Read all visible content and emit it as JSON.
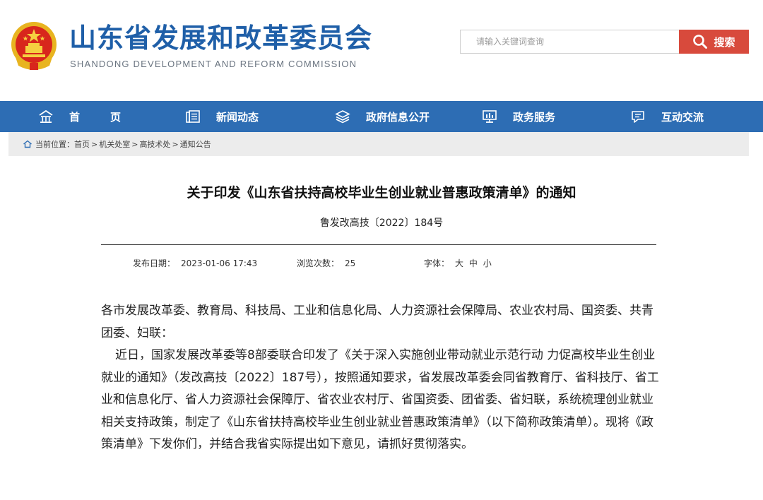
{
  "header": {
    "title": "山东省发展和改革委员会",
    "subtitle": "SHANDONG DEVELOPMENT AND REFORM COMMISSION",
    "emblem_icon": "national-emblem-icon"
  },
  "search": {
    "placeholder": "请输入关键词查询",
    "button_label": "搜索"
  },
  "nav": {
    "items": [
      {
        "label": "首　页",
        "icon": "home-icon"
      },
      {
        "label": "新闻动态",
        "icon": "news-icon"
      },
      {
        "label": "政府信息公开",
        "icon": "layers-icon"
      },
      {
        "label": "政务服务",
        "icon": "monitor-icon"
      },
      {
        "label": "互动交流",
        "icon": "chat-icon"
      }
    ]
  },
  "breadcrumb": {
    "prefix": "当前位置：",
    "items": [
      "首页",
      "机关处室",
      "高技术处",
      "通知公告"
    ],
    "separator": ">"
  },
  "article": {
    "title": "关于印发《山东省扶持高校毕业生创业就业普惠政策清单》的通知",
    "doc_number": "鲁发改高技〔2022〕184号",
    "meta": {
      "publish_label": "发布日期：",
      "publish_date": "2023-01-06 17:43",
      "views_label": "浏览次数：",
      "views": "25",
      "font_label": "字体：",
      "font_large": "大",
      "font_medium": "中",
      "font_small": "小"
    },
    "paragraphs": [
      "各市发展改革委、教育局、科技局、工业和信息化局、人力资源社会保障局、农业农村局、国资委、共青团委、妇联：",
      "近日，国家发展改革委等8部委联合印发了《关于深入实施创业带动就业示范行动 力促高校毕业生创业就业的通知》（发改高技〔2022〕187号），按照通知要求，省发展改革委会同省教育厅、省科技厅、省工业和信息化厅、省人力资源社会保障厅、省农业农村厅、省国资委、团省委、省妇联，系统梳理创业就业相关支持政策，制定了《山东省扶持高校毕业生创业就业普惠政策清单》（以下简称政策清单）。现将《政策清单》下发你们，并结合我省实际提出如下意见，请抓好贯彻落实。"
    ]
  },
  "colors": {
    "brand_blue": "#1f5fa8",
    "nav_blue": "#2d6db4",
    "search_red": "#d84a3c",
    "breadcrumb_bg": "#ececec"
  }
}
